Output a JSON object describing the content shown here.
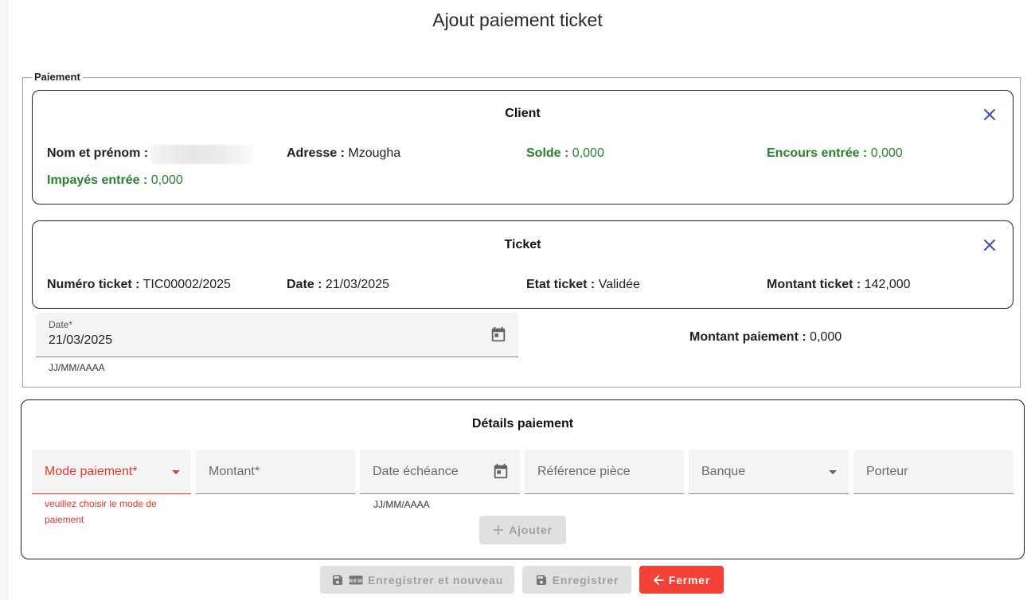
{
  "page": {
    "title": "Ajout paiement ticket"
  },
  "paiement": {
    "legend": "Paiement",
    "client": {
      "title": "Client",
      "nom_label": "Nom et prénom :",
      "adresse_label": "Adresse :",
      "adresse_value": "Mzougha",
      "solde_label": "Solde :",
      "solde_value": "0,000",
      "encours_label": "Encours entrée :",
      "encours_value": "0,000",
      "impayes_label": "Impayés entrée :",
      "impayes_value": "0,000"
    },
    "ticket": {
      "title": "Ticket",
      "numero_label": "Numéro ticket :",
      "numero_value": "TIC00002/2025",
      "date_label": "Date :",
      "date_value": "21/03/2025",
      "etat_label": "Etat ticket :",
      "etat_value": "Validée",
      "montant_label": "Montant ticket :",
      "montant_value": "142,000"
    },
    "date_field": {
      "label": "Date*",
      "value": "21/03/2025",
      "hint": "JJ/MM/AAAA"
    },
    "montant_paiement_label": "Montant paiement :",
    "montant_paiement_value": "0,000"
  },
  "details": {
    "title": "Détails paiement",
    "mode_paiement": {
      "label": "Mode paiement*",
      "error": "veuillez choisir le mode de paiement"
    },
    "montant": {
      "label": "Montant*"
    },
    "date_echeance": {
      "label": "Date échéance",
      "hint": "JJ/MM/AAAA"
    },
    "reference": {
      "label": "Référence pièce"
    },
    "banque": {
      "label": "Banque"
    },
    "porteur": {
      "label": "Porteur"
    },
    "add_button": "Ajouter"
  },
  "footer": {
    "save_new": "Enregistrer et nouveau",
    "save": "Enregistrer",
    "close": "Fermer"
  },
  "colors": {
    "green": "#2e7d32",
    "danger": "#f44336",
    "error": "#e53935",
    "close_icon": "#3f51b5"
  },
  "icons": [
    "close-icon",
    "calendar-icon",
    "caret-down-icon",
    "plus-icon",
    "save-icon",
    "new-icon",
    "arrow-left-icon"
  ]
}
